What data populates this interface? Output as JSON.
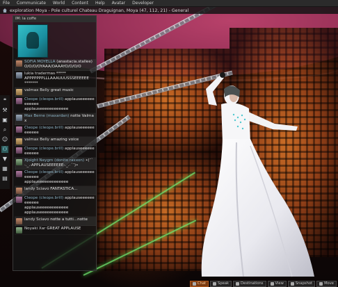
{
  "menu": [
    "File",
    "Communicate",
    "World",
    "Content",
    "Help",
    "Avatar",
    "Developer"
  ],
  "title": "exploration Moya - Pole culturel Chateau Draguignan, Moya (47, 112, 21) - General",
  "im": {
    "window_title": "IM: la coffe",
    "messages": [
      {
        "name": "SOFIA MOYELLA",
        "text": "(anastacia.stallee)\nO/O/O/OYAAA/OAAAYO/O/O/O",
        "alt": true,
        "av": "c1"
      },
      {
        "name": "lukia tradermas",
        "text": "*****\nAPPPPPPPLLLAAAUUUSSSEEEEEE\n*******",
        "alt": false,
        "av": "c2"
      },
      {
        "name": "valmax Belly",
        "text": "great music",
        "alt": true,
        "av": "c3"
      },
      {
        "name": "Cleope (cleope.brill)",
        "text": "applauseeeeeeeeeeee\napplauseeeeeeeeeeee",
        "alt": false,
        "av": "c5"
      },
      {
        "name": "Max Berne (maxardan)",
        "text": "notte Valmax",
        "alt": true,
        "av": "c2"
      },
      {
        "name": "Cleope (cleope.brill)",
        "text": "applauseeeeeeeeeeee",
        "alt": false,
        "av": "c5"
      },
      {
        "name": "valmax Belly",
        "text": "amazing voice",
        "alt": true,
        "av": "c3"
      },
      {
        "name": "Cleope (cleope.brill)",
        "text": "applauseeeeeeeeeeee",
        "alt": false,
        "av": "c5"
      },
      {
        "name": "Xjoight Neygm (donito raxxon)",
        "text": "•(¯`·._.·APPLAUSEEEEEE·._.·´¯)•",
        "alt": true,
        "av": "c4"
      },
      {
        "name": "Cleope (cleope.brill)",
        "text": "applauseeeeeeeeeeee\napplauseeeeeeeeeeee",
        "alt": false,
        "av": "c5"
      },
      {
        "name": "landy Sciavo",
        "text": "FANTASTICA...",
        "alt": true,
        "av": "c1"
      },
      {
        "name": "Cleope (cleope.brill)",
        "text": "applauseeeeeeeeeeee\napplauseeeeeeeeeeee\napplauseeeeeeeeeeee",
        "alt": false,
        "av": "c5"
      },
      {
        "name": "landy Sciavo",
        "text": "notte a tutti...notte",
        "alt": true,
        "av": "c1"
      },
      {
        "name": "Noyaki Xar",
        "text": "GREAT APPLAUSE",
        "alt": false,
        "av": "c4"
      }
    ]
  },
  "toolbar": [
    {
      "icon": "speak-icon",
      "glyph": "❝"
    },
    {
      "icon": "build-icon",
      "glyph": "⚒"
    },
    {
      "icon": "snapshot-icon",
      "glyph": "▣"
    },
    {
      "icon": "search-icon",
      "glyph": "⌕"
    },
    {
      "icon": "avatar-icon",
      "glyph": "☺"
    },
    {
      "icon": "people-icon",
      "glyph": "⚇"
    },
    {
      "icon": "places-icon",
      "glyph": "▼"
    },
    {
      "icon": "mini-map-icon",
      "glyph": "▦"
    },
    {
      "icon": "inventory-icon",
      "glyph": "▤"
    }
  ],
  "bottom_buttons": [
    {
      "label": "Chat",
      "name": "chat-button",
      "highlight": true
    },
    {
      "label": "Speak",
      "name": "speak-button"
    },
    {
      "label": "Destinations",
      "name": "destinations-button"
    },
    {
      "label": "View",
      "name": "view-button"
    },
    {
      "label": "Snapshot",
      "name": "snapshot-button"
    },
    {
      "label": "Move",
      "name": "move-button"
    }
  ]
}
